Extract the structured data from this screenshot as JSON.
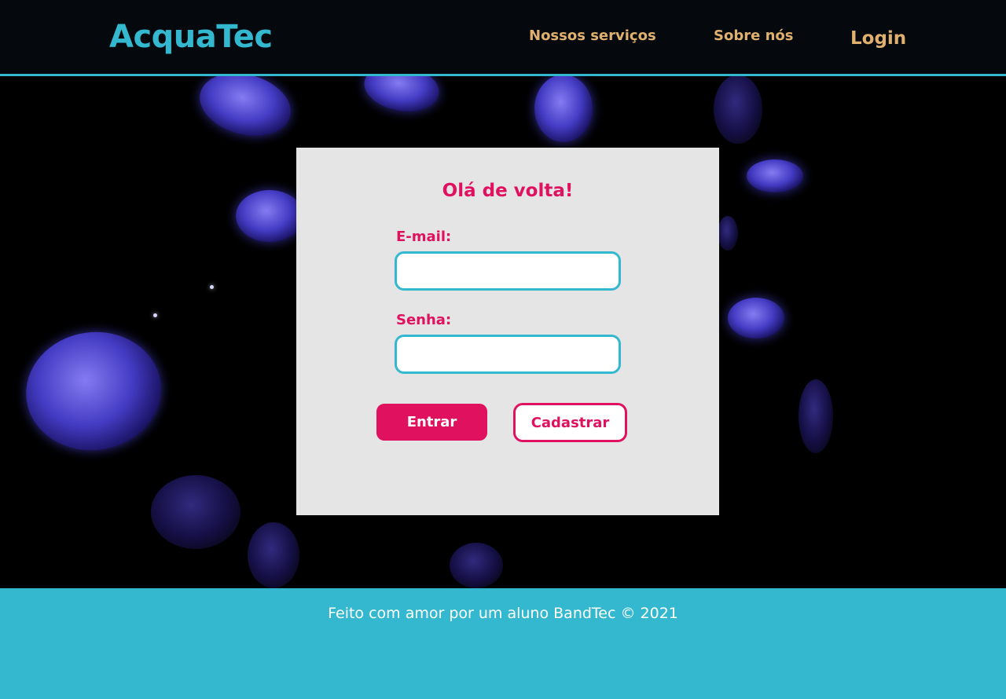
{
  "header": {
    "brand": "AcquaTec",
    "nav": {
      "services": "Nossos serviços",
      "about": "Sobre nós",
      "login": "Login"
    }
  },
  "login_card": {
    "title": "Olá de volta!",
    "email_label": "E-mail:",
    "email_value": "",
    "password_label": "Senha:",
    "password_value": "",
    "enter_button": "Entrar",
    "register_button": "Cadastrar"
  },
  "footer": {
    "text": "Feito com amor por um aluno BandTec © 2021"
  },
  "colors": {
    "brand_cyan": "#33b8d0",
    "nav_gold": "#dfb06e",
    "accent_pink": "#e0115f",
    "card_bg": "#e5e5e5",
    "header_bg": "#05080c"
  }
}
